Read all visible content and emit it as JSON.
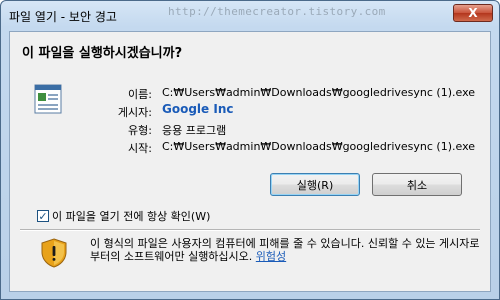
{
  "window": {
    "title": "파일 열기 - 보안 경고",
    "watermark": "http://themecreator.tistory.com",
    "close_symbol": "X"
  },
  "dialog": {
    "question": "이 파일을 실행하시겠습니까?",
    "details": [
      {
        "label": "이름:",
        "value": "C:₩Users₩admin₩Downloads₩googledrivesync (1).exe"
      },
      {
        "label": "게시자:",
        "value": "Google Inc"
      },
      {
        "label": "유형:",
        "value": "응용 프로그램"
      },
      {
        "label": "시작:",
        "value": "C:₩Users₩admin₩Downloads₩googledrivesync (1).exe"
      }
    ],
    "run_button": "실행(R)",
    "cancel_button": "취소",
    "always_ask": {
      "checked": true,
      "label": "이 파일을 열기 전에 항상 확인(W)"
    },
    "warning": {
      "text": "이 형식의 파일은 사용자의 컴퓨터에 피해를 줄 수 있습니다. 신뢰할 수 있는 게시자로부터의 소프트웨어만 실행하십시오.",
      "link": "위험성"
    }
  },
  "colors": {
    "link": "#1a5bb8",
    "shield": "#e8a21a",
    "close_button": "#c9533a"
  },
  "icons": {
    "file": "application-file-icon",
    "warning": "shield-warning-icon",
    "check": "checkmark-icon"
  }
}
